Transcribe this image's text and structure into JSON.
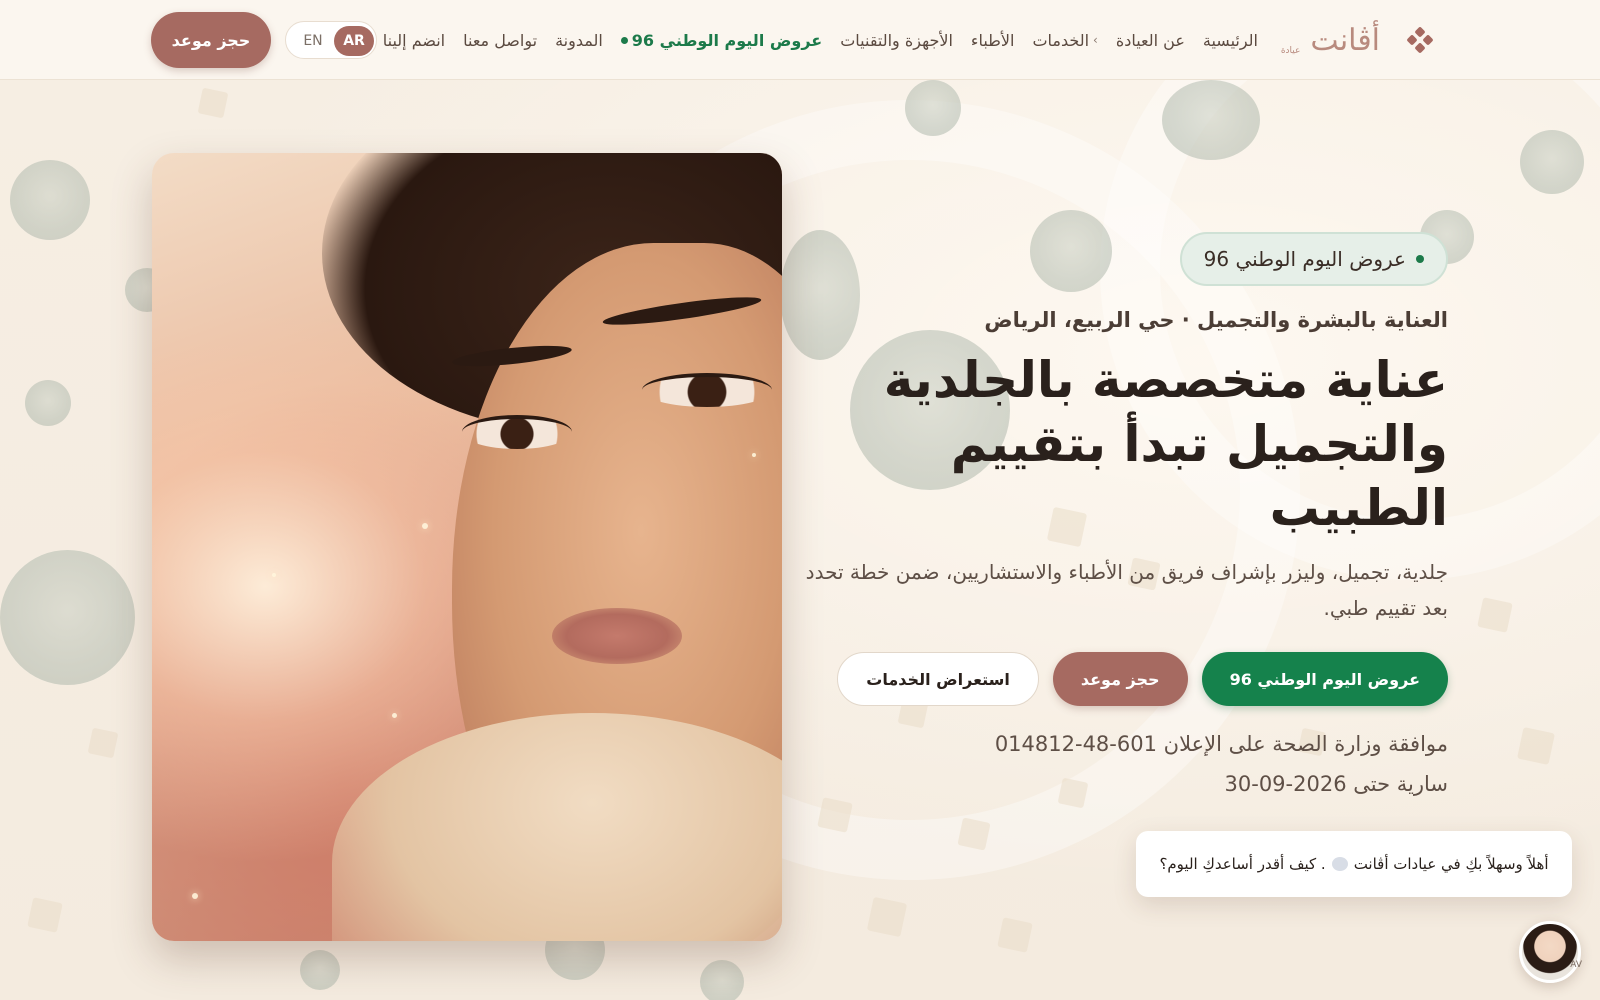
{
  "header": {
    "book_button": "حجز موعد",
    "lang": {
      "en": "EN",
      "ar": "AR",
      "active": "AR"
    },
    "nav": [
      {
        "label": "الرئيسية",
        "name": "nav-home"
      },
      {
        "label": "عن العيادة",
        "name": "nav-about"
      },
      {
        "label": "الخدمات",
        "name": "nav-services",
        "has_dropdown": true
      },
      {
        "label": "الأطباء",
        "name": "nav-doctors"
      },
      {
        "label": "الأجهزة والتقنيات",
        "name": "nav-devices"
      },
      {
        "label": "عروض اليوم الوطني 96",
        "name": "nav-national-day-offers",
        "highlight": true
      },
      {
        "label": "المدونة",
        "name": "nav-blog"
      },
      {
        "label": "تواصل معنا",
        "name": "nav-contact"
      },
      {
        "label": "انضم إلينا",
        "name": "nav-join"
      }
    ],
    "logo": {
      "word": "أڤانت",
      "sub": "عيادة"
    }
  },
  "hero": {
    "badge": "عروض اليوم الوطني 96",
    "subtitle": "العناية بالبشرة والتجميل · حي الربيع، الرياض",
    "headline": "عناية متخصصة بالجلدية والتجميل تبدأ بتقييم الطبيب",
    "description": "جلدية، تجميل، وليزر بإشراف فريق من الأطباء والاستشاريين، ضمن خطة تحدد بعد تقييم طبي.",
    "cta": {
      "offers": "عروض اليوم الوطني 96",
      "book": "حجز موعد",
      "services": "استعراض الخدمات"
    },
    "license": "موافقة وزارة الصحة على الإعلان 601-48-014812",
    "valid_until": "سارية حتى 2026-09-30"
  },
  "chat": {
    "greeting_part1": "أهلاً وسهلاً بكِ في عيادات أڤانت",
    "greeting_part2": ". كيف أقدر أساعدكِ اليوم؟",
    "avatar_status": "AV"
  },
  "colors": {
    "brand_rose": "#a66a61",
    "brand_green": "#15824c",
    "background": "#f7efe4"
  },
  "icons": {
    "logo_mark": "diamond-cluster-icon",
    "nav_dropdown": "chevron-down-icon",
    "badge_dot": "dot-icon",
    "wave": "waving-hand-icon"
  }
}
